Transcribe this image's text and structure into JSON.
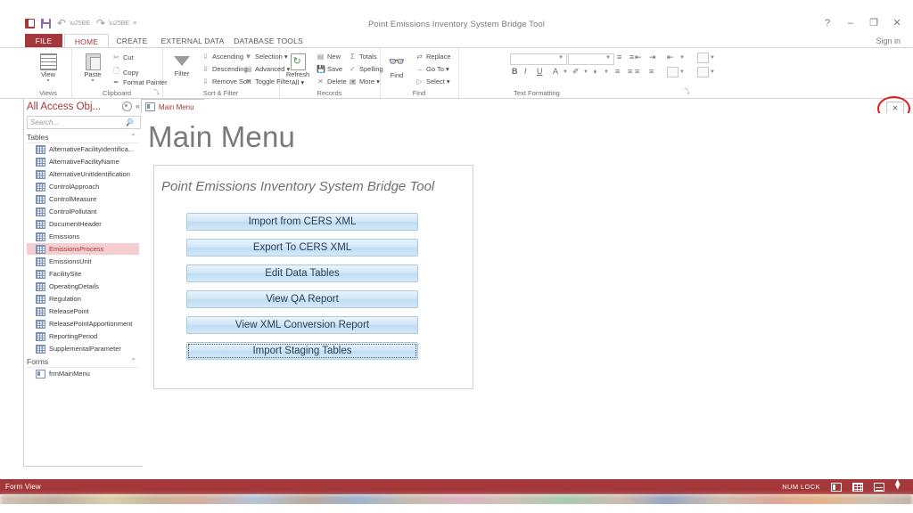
{
  "window": {
    "title": "Point Emissions Inventory System Bridge Tool",
    "help_label": "?",
    "minimize_label": "–",
    "restore_label": "❐",
    "close_label": "✕",
    "signin_label": "Sign in",
    "accent_color": "#a4373a"
  },
  "quick_access": {
    "items": [
      {
        "name": "access-app-icon",
        "label": ""
      },
      {
        "name": "save-icon",
        "label": ""
      },
      {
        "name": "undo-icon",
        "label": "↶"
      },
      {
        "name": "redo-icon",
        "label": "↷"
      },
      {
        "name": "customize-qat-icon",
        "label": "≡"
      }
    ]
  },
  "ribbon": {
    "tabs": [
      {
        "label": "FILE",
        "active": false,
        "file": true
      },
      {
        "label": "HOME",
        "active": true,
        "file": false
      },
      {
        "label": "CREATE",
        "active": false,
        "file": false
      },
      {
        "label": "EXTERNAL DATA",
        "active": false,
        "file": false
      },
      {
        "label": "DATABASE TOOLS",
        "active": false,
        "file": false
      }
    ],
    "groups": {
      "views": {
        "label": "Views",
        "view_button": "View",
        "view_caret": "▾"
      },
      "clipboard": {
        "label": "Clipboard",
        "paste_button": "Paste",
        "paste_caret": "▾",
        "cut": "Cut",
        "copy": "Copy",
        "format_painter": "Format Painter",
        "dialog_launcher": "⤵"
      },
      "sort_filter": {
        "label": "Sort & Filter",
        "filter_button": "Filter",
        "ascending": "Ascending",
        "descending": "Descending",
        "remove_sort": "Remove Sort",
        "selection": "Selection ▾",
        "advanced": "Advanced ▾",
        "toggle_filter": "Toggle Filter"
      },
      "records": {
        "label": "Records",
        "refresh_all": "Refresh",
        "refresh_all_2": "All ▾",
        "new": "New",
        "save": "Save",
        "delete": "Delete",
        "delete_caret": "▾",
        "totals": "Totals",
        "spelling": "Spelling",
        "more": "More ▾"
      },
      "find": {
        "label": "Find",
        "find_button": "Find",
        "replace": "Replace",
        "go_to": "Go To ▾",
        "select": "Select ▾"
      },
      "text_formatting": {
        "label": "Text Formatting",
        "bold": "B",
        "italic": "I",
        "underline": "U",
        "font_color": "A",
        "highlight": "✐",
        "fill_color": "◑",
        "dialog_launcher": "⤵"
      }
    }
  },
  "nav_pane": {
    "title": "All Access Obj...",
    "shutter_icon": "«",
    "search": {
      "placeholder": "Search...",
      "value": "",
      "icon": "search-icon"
    },
    "groups": [
      {
        "label": "Tables",
        "collapse_icon": "⌃",
        "items": [
          {
            "label": "AlternativeFacilityIdentifica...",
            "selected": false
          },
          {
            "label": "AlternativeFacilityName",
            "selected": false
          },
          {
            "label": "AlternativeUnitIdentification",
            "selected": false
          },
          {
            "label": "ControlApproach",
            "selected": false
          },
          {
            "label": "ControlMeasure",
            "selected": false
          },
          {
            "label": "ControlPollutant",
            "selected": false
          },
          {
            "label": "DocumentHeader",
            "selected": false
          },
          {
            "label": "Emissions",
            "selected": false
          },
          {
            "label": "EmissionsProcess",
            "selected": true
          },
          {
            "label": "EmissionsUnit",
            "selected": false
          },
          {
            "label": "FacilitySite",
            "selected": false
          },
          {
            "label": "OperatingDetails",
            "selected": false
          },
          {
            "label": "Regulation",
            "selected": false
          },
          {
            "label": "ReleasePoint",
            "selected": false
          },
          {
            "label": "ReleasePointApportionment",
            "selected": false
          },
          {
            "label": "ReportingPeriod",
            "selected": false
          },
          {
            "label": "SupplementalParameter",
            "selected": false
          }
        ]
      },
      {
        "label": "Forms",
        "collapse_icon": "⌃",
        "items": [
          {
            "label": "frmMainMenu",
            "selected": false
          }
        ]
      }
    ]
  },
  "document": {
    "tab_label": "Main Menu",
    "close_label": "✕"
  },
  "form": {
    "title": "Main Menu",
    "panel_heading": "Point Emissions Inventory System Bridge Tool",
    "buttons": [
      {
        "label": "Import from CERS XML",
        "focused": false
      },
      {
        "label": "Export To CERS XML",
        "focused": false
      },
      {
        "label": "Edit Data Tables",
        "focused": false
      },
      {
        "label": "View QA Report",
        "focused": false
      },
      {
        "label": "View XML Conversion Report",
        "focused": false
      },
      {
        "label": "Import Staging Tables",
        "focused": true
      }
    ]
  },
  "status_bar": {
    "view_mode": "Form View",
    "num_lock": "NUM LOCK",
    "view_buttons": [
      {
        "name": "form-view-button",
        "label": ""
      },
      {
        "name": "datasheet-view-button",
        "label": ""
      },
      {
        "name": "layout-view-button",
        "label": ""
      },
      {
        "name": "design-view-button",
        "label": ""
      }
    ]
  }
}
